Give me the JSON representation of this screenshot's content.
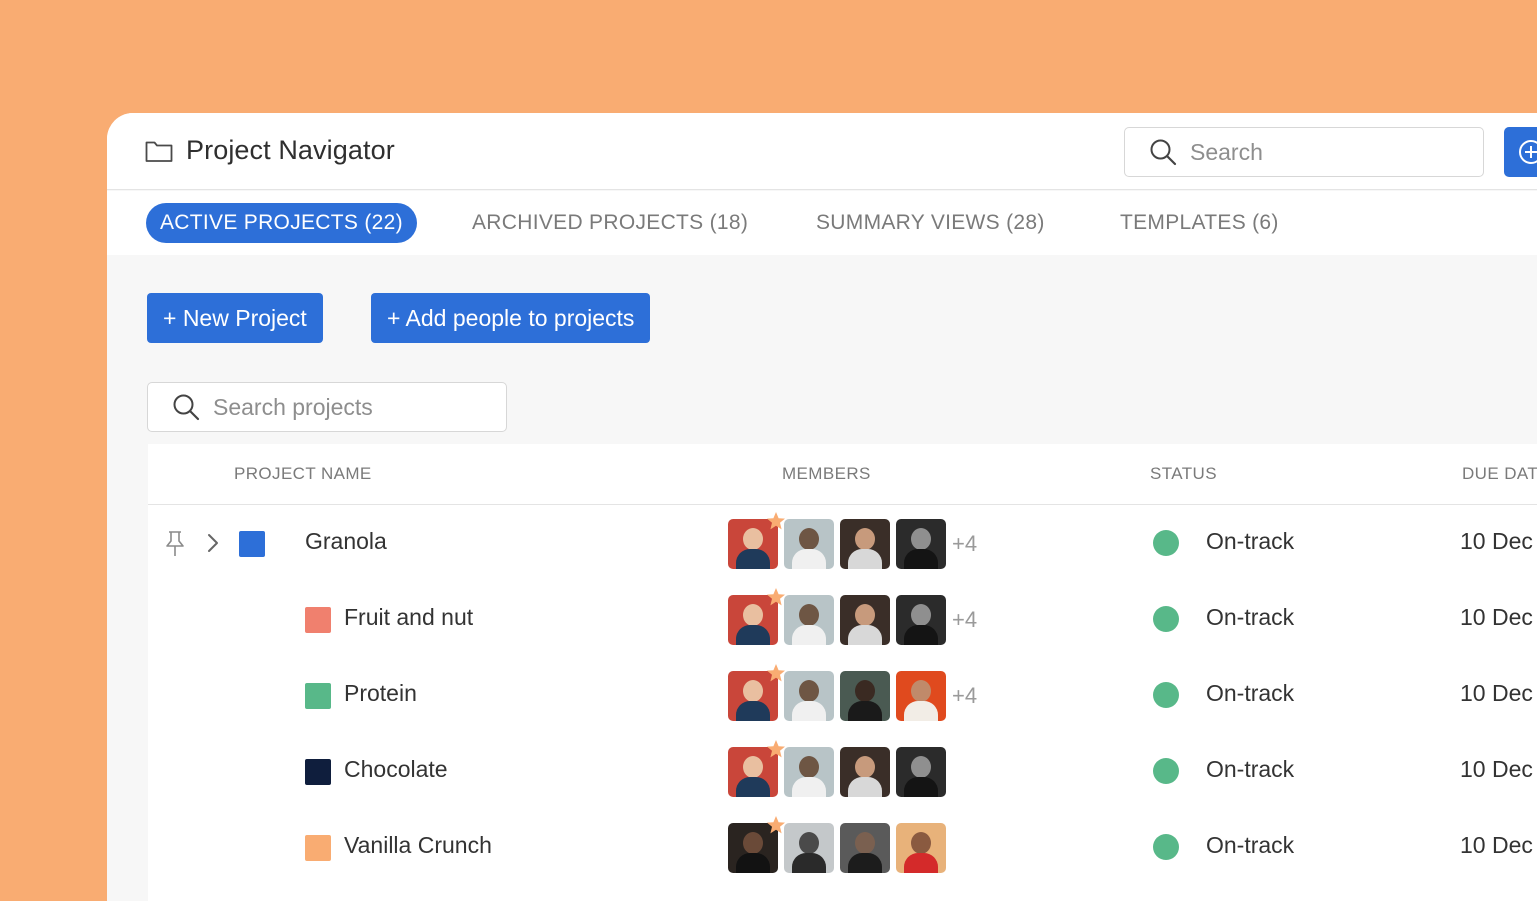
{
  "app": {
    "title": "Project Navigator"
  },
  "header": {
    "search_placeholder": "Search"
  },
  "tabs": [
    {
      "label": "ACTIVE PROJECTS (22)",
      "active": true
    },
    {
      "label": "ARCHIVED PROJECTS (18)",
      "active": false
    },
    {
      "label": "SUMMARY VIEWS (28)",
      "active": false
    },
    {
      "label": "TEMPLATES (6)",
      "active": false
    }
  ],
  "actions": {
    "new_project": "+ New Project",
    "add_people": "+ Add people to projects"
  },
  "project_search": {
    "placeholder": "Search projects"
  },
  "table": {
    "columns": {
      "name": "PROJECT NAME",
      "members": "MEMBERS",
      "status": "STATUS",
      "due": "DUE DAT"
    },
    "rows": [
      {
        "name": "Granola",
        "color": "#2D6FD8",
        "more": "+4",
        "status": "On-track",
        "due": "10 Dec",
        "pinned": true,
        "expandable": true
      },
      {
        "name": "Fruit and nut",
        "color": "#F0806E",
        "more": "+4",
        "status": "On-track",
        "due": "10 Dec"
      },
      {
        "name": "Protein",
        "color": "#58B889",
        "more": "+4",
        "status": "On-track",
        "due": "10 Dec"
      },
      {
        "name": "Chocolate",
        "color": "#0F1E3D",
        "more": "",
        "status": "On-track",
        "due": "10 Dec"
      },
      {
        "name": "Vanilla Crunch",
        "color": "#F9AC72",
        "more": "",
        "status": "On-track",
        "due": "10 Dec"
      }
    ]
  },
  "colors": {
    "accent": "#2D6FD8",
    "background": "#F9AC72",
    "on_track": "#58B889"
  }
}
